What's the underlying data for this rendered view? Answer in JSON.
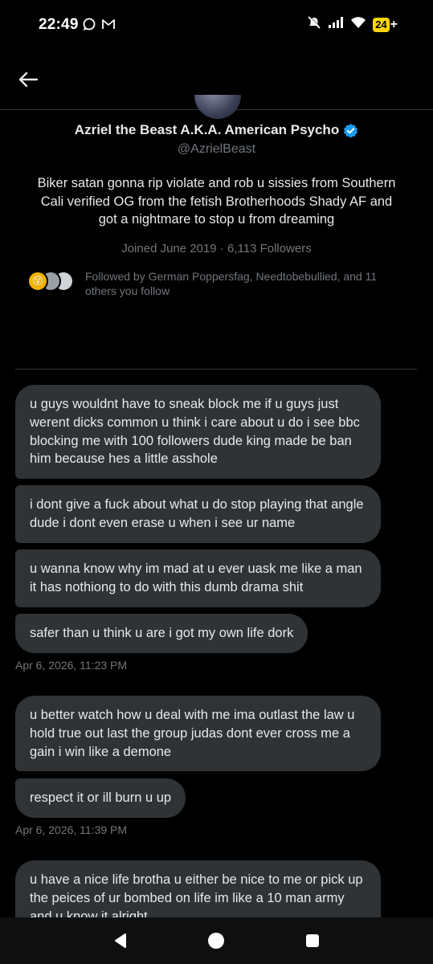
{
  "status_bar": {
    "time": "22:49",
    "battery": "24",
    "left_icons": [
      "chat-bubble-icon",
      "gmail-icon"
    ],
    "right_icons": [
      "mute-icon",
      "signal-icon",
      "wifi-icon",
      "battery-icon"
    ]
  },
  "header": {
    "back_icon": "arrow-left-icon"
  },
  "profile": {
    "name": "Azriel the Beast A.K.A. American Psycho",
    "handle": "@AzrielBeast",
    "bio": "Biker satan gonna rip violate and rob u sissies from Southern Cali verified OG from the fetish Brotherhoods Shady AF and got a nightmare to stop u from dreaming",
    "meta": "Joined June 2019 · 6,113 Followers",
    "followed_by": "Followed by German Poppersfag, Needtobebullied, and 11 others you follow",
    "verified_color": "#1d9bf0"
  },
  "messages": [
    {
      "text": "u guys wouldnt have to sneak block me if u guys just werent dicks common u think i care about u do i see bbc blocking me with 100 followers dude king made be ban him because hes a little asshole"
    },
    {
      "text": "i dont give a fuck about what u do stop playing that angle dude i dont even erase u when i see ur name"
    },
    {
      "text": "u wanna know why im mad at u ever uask me like a man it has nothiong to do with this dumb drama shit"
    },
    {
      "text": "safer than u think u are  i got my own life dork"
    },
    {
      "text": "u better watch how u deal with me ima  outlast the law u hold true out last the group judas dont ever cross me a gain i win like a demone"
    },
    {
      "text": "respect it or ill burn u up"
    },
    {
      "text": "u have a nice life brotha u either be nice to me or pick up the peices of ur bombed on life im like a 10 man army and u know it alright"
    }
  ],
  "timestamps": [
    "Apr 6, 2026, 11:23 PM",
    "Apr 6, 2026, 11:39 PM"
  ],
  "nav": {
    "back": "nav-back-icon",
    "home": "nav-home-icon",
    "recents": "nav-recents-icon"
  },
  "colors": {
    "background": "#000000",
    "bubble": "#2f3336",
    "muted_text": "#71767b",
    "battery": "#ffd600"
  }
}
